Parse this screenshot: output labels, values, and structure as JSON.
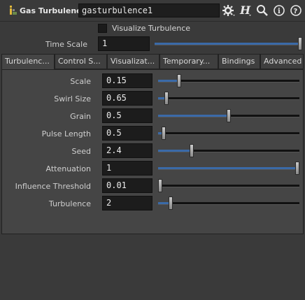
{
  "header": {
    "node_type": "Gas Turbulence",
    "node_name": "gasturbulence1",
    "icons": [
      "gear-icon",
      "h-help-icon",
      "search-icon",
      "info-icon",
      "help-icon"
    ]
  },
  "visualize_turbulence": {
    "label": "Visualize Turbulence",
    "checked": false
  },
  "time_scale": {
    "label": "Time Scale",
    "value": "1",
    "slider_fraction": 1.0
  },
  "tabs": [
    {
      "label": "Turbulenc...",
      "active": true
    },
    {
      "label": "Control S...",
      "active": false
    },
    {
      "label": "Visualizat...",
      "active": false
    },
    {
      "label": "Temporary...",
      "active": false
    },
    {
      "label": "Bindings",
      "active": false
    },
    {
      "label": "Advanced",
      "active": false
    }
  ],
  "params": [
    {
      "label": "Scale",
      "value": "0.15",
      "fill_fraction": 0.15
    },
    {
      "label": "Swirl Size",
      "value": "0.65",
      "fill_fraction": 0.06
    },
    {
      "label": "Grain",
      "value": "0.5",
      "fill_fraction": 0.5
    },
    {
      "label": "Pulse Length",
      "value": "0.5",
      "fill_fraction": 0.04
    },
    {
      "label": "Seed",
      "value": "2.4",
      "fill_fraction": 0.24
    },
    {
      "label": "Attenuation",
      "value": "1",
      "fill_fraction": 1.0
    },
    {
      "label": "Influence Threshold",
      "value": "0.01",
      "fill_fraction": 0.0
    },
    {
      "label": "Turbulence",
      "value": "2",
      "fill_fraction": 0.09
    }
  ],
  "colors": {
    "accent": "#3a6aa8",
    "background": "#3a3a3a",
    "panel": "#454545",
    "field": "#1c1c1c"
  }
}
